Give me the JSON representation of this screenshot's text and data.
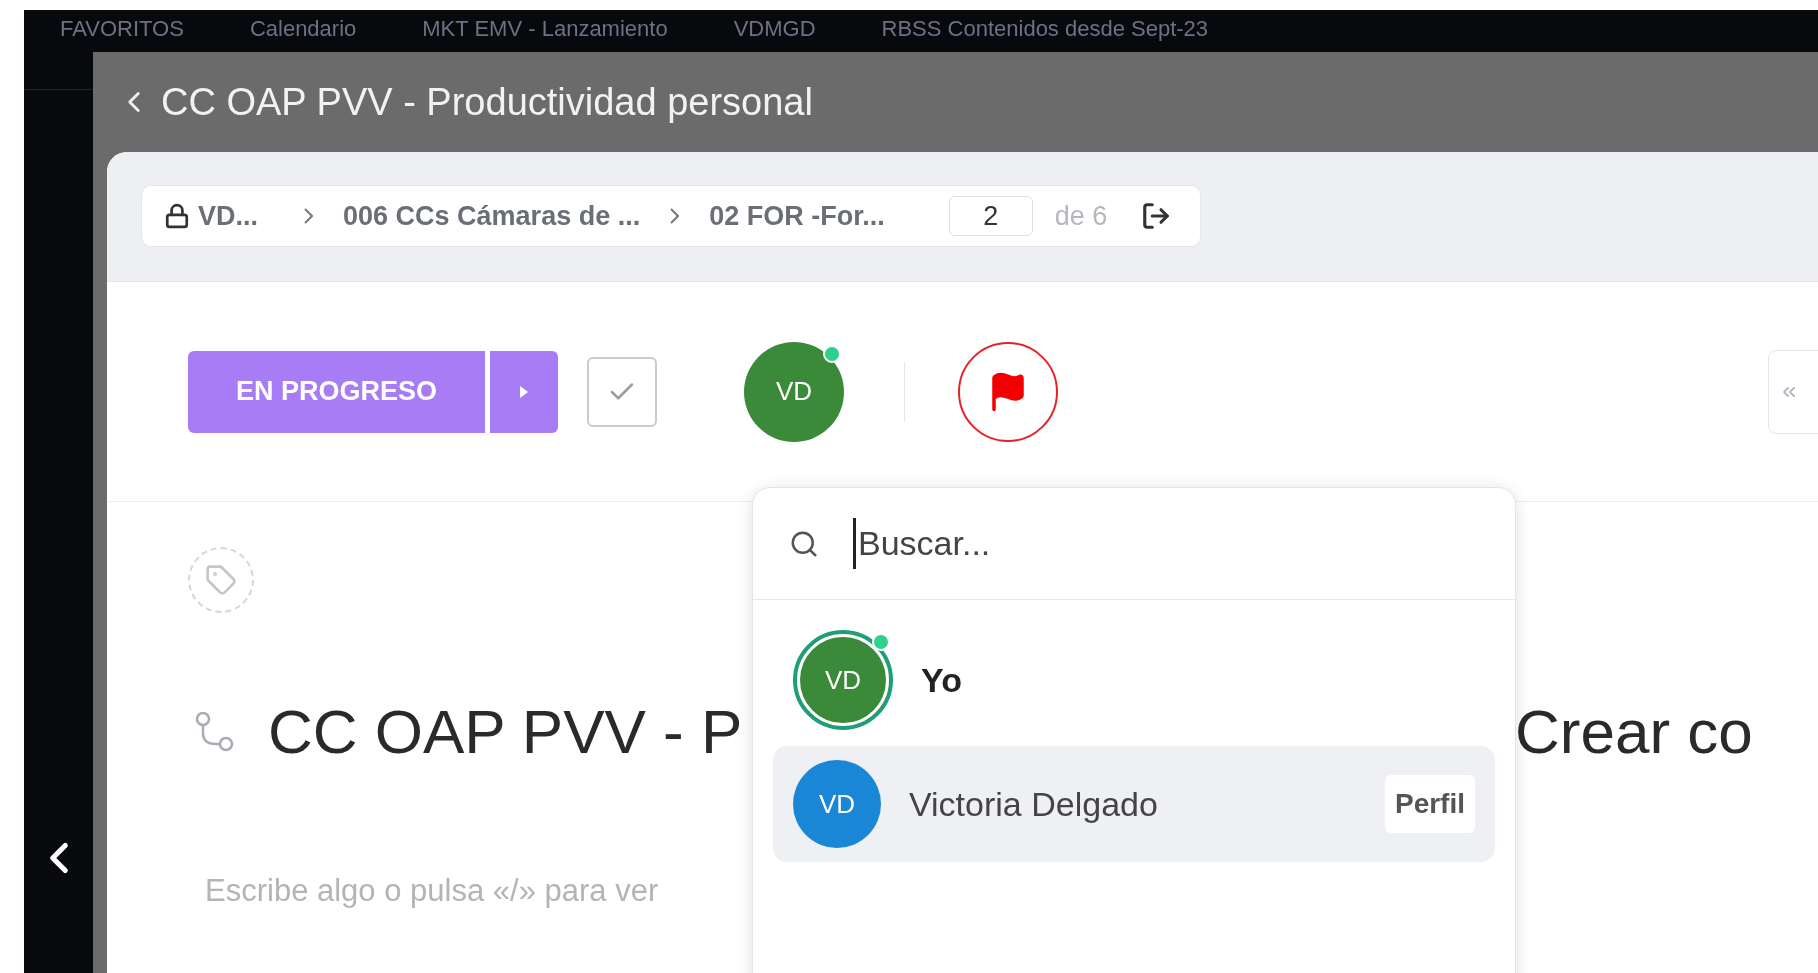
{
  "bookmarks": [
    "FAVORITOS",
    "Calendario",
    "MKT EMV - Lanzamiento",
    "VDMGD",
    "RBSS Contenidos desde Sept-23"
  ],
  "modal": {
    "title": "CC OAP PVV - Productividad personal"
  },
  "breadcrumb": {
    "items": [
      "VD...",
      "006 CCs Cámaras de ...",
      "02 FOR -For..."
    ],
    "page": "2",
    "of": "de 6"
  },
  "status": {
    "label": "EN PROGRESO",
    "color": "#a77cf5"
  },
  "assignee": {
    "initials": "VD",
    "online": true,
    "color": "#3a8a3a"
  },
  "task": {
    "title": "CC OAP PVV - P",
    "side_text": "Crear co",
    "placeholder": "Escribe algo o pulsa «/» para ver"
  },
  "dropdown": {
    "search_placeholder": "Buscar...",
    "people": [
      {
        "kind": "self",
        "initials": "VD",
        "name": "Yo",
        "color": "#3a8a3a",
        "online": true,
        "selected": false
      },
      {
        "kind": "member",
        "initials": "VD",
        "name": "Victoria Delgado",
        "color": "#1a86d6",
        "online": false,
        "selected": true,
        "action": "Perfil"
      }
    ]
  }
}
